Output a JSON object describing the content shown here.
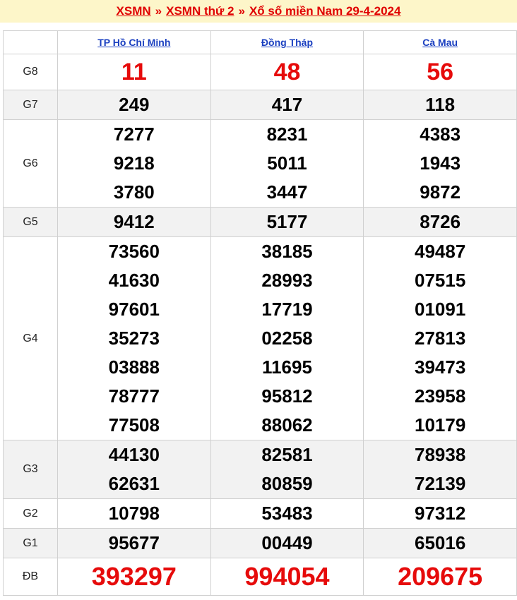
{
  "breadcrumb": {
    "item1": "XSMN",
    "sep": "»",
    "item2": "XSMN thứ 2",
    "item3": "Xổ số miền Nam 29-4-2024"
  },
  "provinces": [
    "TP Hồ Chí Minh",
    "Đồng Tháp",
    "Cà Mau"
  ],
  "prizes": [
    {
      "label": "G8",
      "values": [
        [
          "11"
        ],
        [
          "48"
        ],
        [
          "56"
        ]
      ]
    },
    {
      "label": "G7",
      "values": [
        [
          "249"
        ],
        [
          "417"
        ],
        [
          "118"
        ]
      ]
    },
    {
      "label": "G6",
      "values": [
        [
          "7277",
          "9218",
          "3780"
        ],
        [
          "8231",
          "5011",
          "3447"
        ],
        [
          "4383",
          "1943",
          "9872"
        ]
      ]
    },
    {
      "label": "G5",
      "values": [
        [
          "9412"
        ],
        [
          "5177"
        ],
        [
          "8726"
        ]
      ]
    },
    {
      "label": "G4",
      "values": [
        [
          "73560",
          "41630",
          "97601",
          "35273",
          "03888",
          "78777",
          "77508"
        ],
        [
          "38185",
          "28993",
          "17719",
          "02258",
          "11695",
          "95812",
          "88062"
        ],
        [
          "49487",
          "07515",
          "01091",
          "27813",
          "39473",
          "23958",
          "10179"
        ]
      ]
    },
    {
      "label": "G3",
      "values": [
        [
          "44130",
          "62631"
        ],
        [
          "82581",
          "80859"
        ],
        [
          "78938",
          "72139"
        ]
      ]
    },
    {
      "label": "G2",
      "values": [
        [
          "10798"
        ],
        [
          "53483"
        ],
        [
          "97312"
        ]
      ]
    },
    {
      "label": "G1",
      "values": [
        [
          "95677"
        ],
        [
          "00449"
        ],
        [
          "65016"
        ]
      ]
    },
    {
      "label": "ĐB",
      "values": [
        [
          "393297"
        ],
        [
          "994054"
        ],
        [
          "209675"
        ]
      ]
    }
  ],
  "colors": {
    "accent_red": "#e60b0b",
    "link_blue": "#1a3fc0",
    "header_bg": "#fdf6c9"
  }
}
